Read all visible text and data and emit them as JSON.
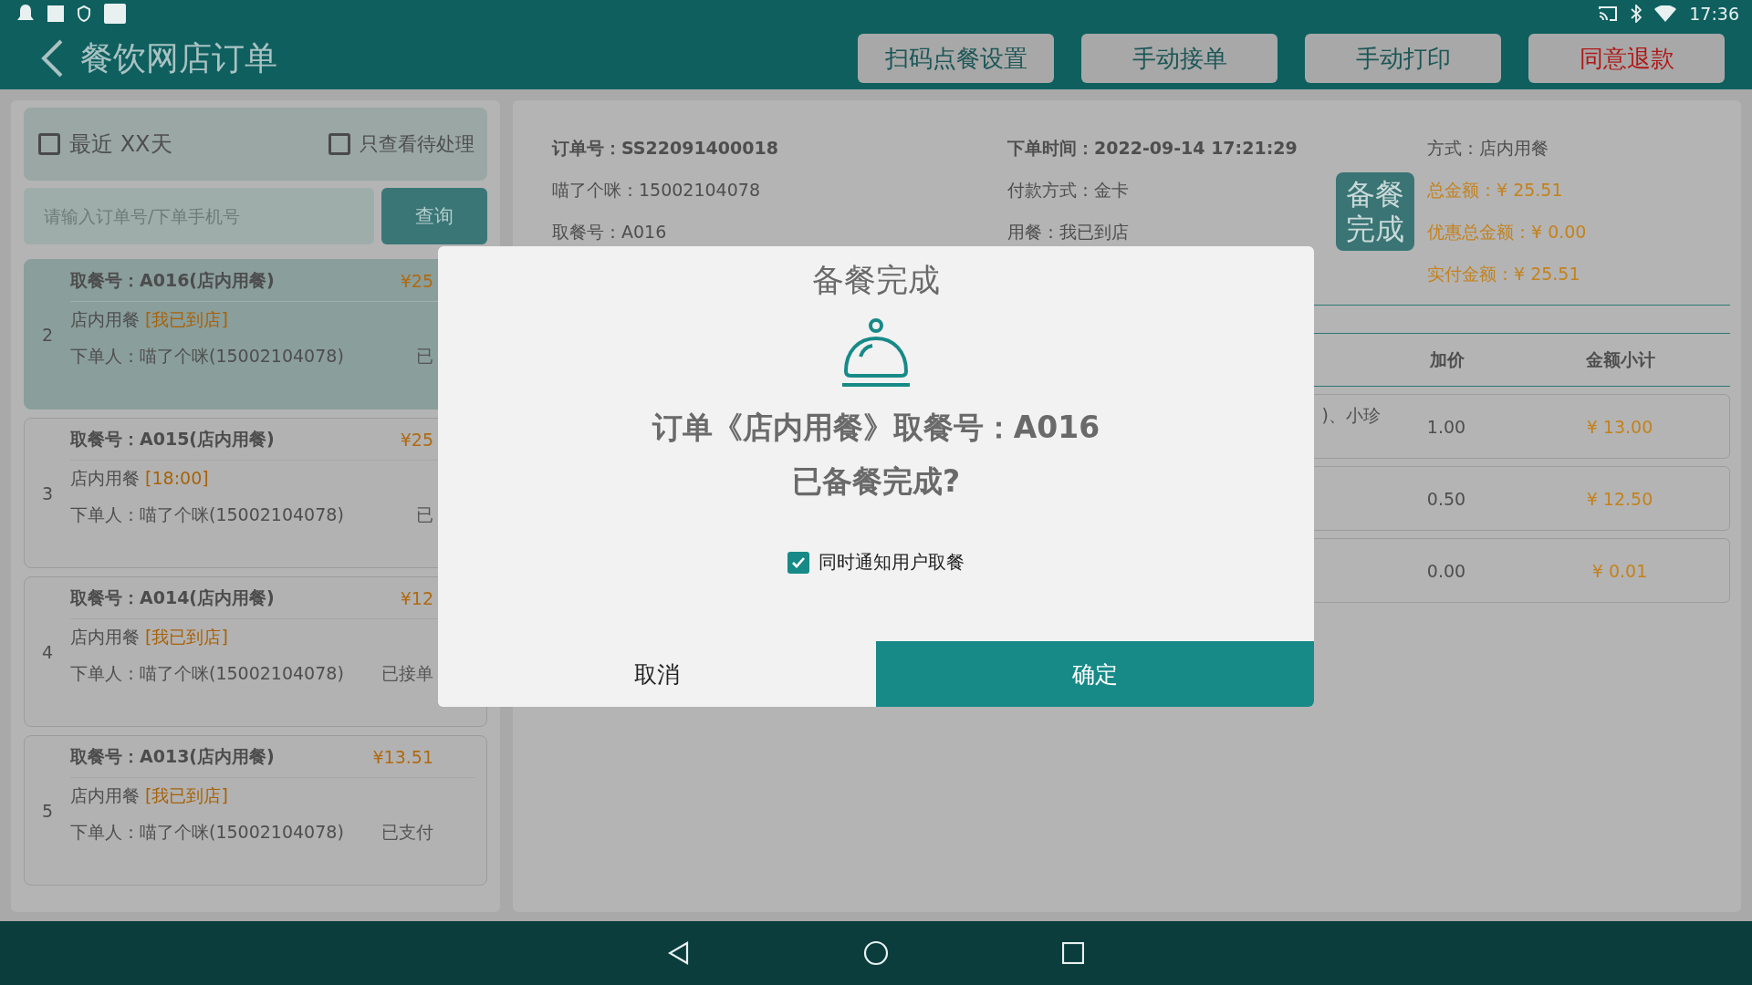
{
  "status_bar": {
    "time": "17:36"
  },
  "header": {
    "title": "餐饮网店订单",
    "buttons": [
      {
        "label": "扫码点餐设置",
        "kind": "normal"
      },
      {
        "label": "手动接单",
        "kind": "normal"
      },
      {
        "label": "手动打印",
        "kind": "normal"
      },
      {
        "label": "同意退款",
        "kind": "danger"
      }
    ]
  },
  "filters": [
    {
      "label": "最近 XX天",
      "checked": false
    },
    {
      "label": "只查看待处理",
      "checked": false
    }
  ],
  "search": {
    "placeholder": "请输入订单号/下单手机号",
    "button": "查询"
  },
  "orders": [
    {
      "index": "2",
      "title": "取餐号：A016(店内用餐)",
      "price": "¥25",
      "type": "店内用餐",
      "tag": "[我已到店]",
      "customer": "下单人：喵了个咪(15002104078)",
      "status": "已",
      "selected": true
    },
    {
      "index": "3",
      "title": "取餐号：A015(店内用餐)",
      "price": "¥25",
      "type": "店内用餐",
      "tag": "[18:00]",
      "customer": "下单人：喵了个咪(15002104078)",
      "status": "已",
      "selected": false
    },
    {
      "index": "4",
      "title": "取餐号：A014(店内用餐)",
      "price": "¥12",
      "type": "店内用餐",
      "tag": "[我已到店]",
      "customer": "下单人：喵了个咪(15002104078)",
      "status": "已接单",
      "selected": false
    },
    {
      "index": "5",
      "title": "取餐号：A013(店内用餐)",
      "price": "¥13.51",
      "type": "店内用餐",
      "tag": "[我已到店]",
      "customer": "下单人：喵了个咪(15002104078)",
      "status": "已支付",
      "selected": false
    }
  ],
  "detail": {
    "fields": [
      {
        "text": "订单号：SS22091400018",
        "bold": true
      },
      {
        "text": "下单时间：2022-09-14 17:21:29",
        "bold": true
      },
      {
        "text": "喵了个咪：15002104078",
        "bold": false
      },
      {
        "text": "付款方式：金卡",
        "bold": false
      },
      {
        "text": "取餐号：A016",
        "bold": false
      },
      {
        "text": "用餐：我已到店",
        "bold": false
      }
    ],
    "badge": "备餐完成",
    "summary": [
      {
        "text": "方式：店内用餐",
        "kind": "plain"
      },
      {
        "text": "总金额：¥ 25.51",
        "kind": "money"
      },
      {
        "text": "优惠总金额：¥ 0.00",
        "kind": "money"
      },
      {
        "text": "实付金额：¥ 25.51",
        "kind": "money"
      }
    ]
  },
  "table": {
    "columns": [
      "加价",
      "金额小计"
    ],
    "rows": [
      {
        "column_1": ")、小珍",
        "extra_price": "1.00",
        "subtotal": "¥ 13.00"
      },
      {
        "extra_price": "0.50",
        "subtotal": "¥ 12.50"
      },
      {
        "extra_price": "0.00",
        "subtotal": "¥ 0.01"
      }
    ]
  },
  "dialog": {
    "title": "备餐完成",
    "message_lines": [
      "订单《店内用餐》取餐号：A016",
      "已备餐完成?"
    ],
    "notify": {
      "label": "同时通知用户取餐",
      "checked": true
    },
    "buttons": [
      {
        "label": "取消",
        "kind": "secondary"
      },
      {
        "label": "确定",
        "kind": "primary"
      }
    ]
  }
}
